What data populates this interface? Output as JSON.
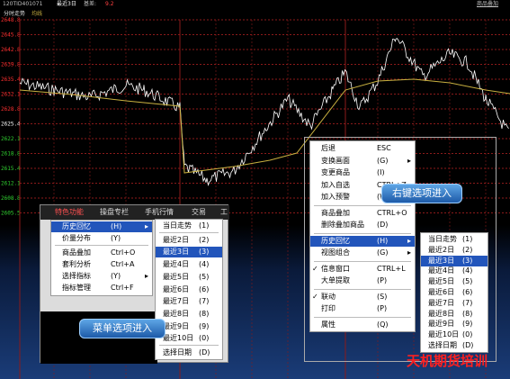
{
  "header": {
    "code": "120TID401071",
    "period_label": "最近3日",
    "base_label": "基差:",
    "base_value": "9.2",
    "overlay_label": "商品叠加"
  },
  "subheader": {
    "chart_title": "分时走势",
    "avg_label": "均线"
  },
  "yaxis": {
    "labels": [
      "2648.8",
      "2645.8",
      "2642.8",
      "2639.8",
      "2635.4",
      "2632.1",
      "2628.8",
      "2625.4",
      "2622.1",
      "2618.8",
      "2615.4",
      "2612.1",
      "2608.8",
      "2605.5"
    ]
  },
  "colors": {
    "price_line": "#ffffff",
    "avg_line": "#c8b040",
    "grid": "#8b1a1a",
    "highlight": "#2255bb",
    "accent": "#ff2020"
  },
  "left_window": {
    "tabs": [
      "特色功能",
      "操盘专栏",
      "手机行情",
      "交易",
      "工"
    ],
    "menu": [
      {
        "label": "历史回忆",
        "key": "(H)",
        "arrow": "▸",
        "highlighted": true
      },
      {
        "label": "价量分布",
        "key": "(Y)"
      },
      {
        "label": "商品叠加",
        "key": "Ctrl+O"
      },
      {
        "label": "套利分析",
        "key": "Ctrl+A"
      },
      {
        "label": "选择指标",
        "key": "(Y)",
        "arrow": "▸"
      },
      {
        "label": "指标管理",
        "key": "Ctrl+F"
      }
    ],
    "submenu": [
      {
        "label": "当日走势",
        "key": "(1)"
      },
      {
        "label": "最近2日",
        "key": "(2)"
      },
      {
        "label": "最近3日",
        "key": "(3)",
        "highlighted": true
      },
      {
        "label": "最近4日",
        "key": "(4)"
      },
      {
        "label": "最近5日",
        "key": "(5)"
      },
      {
        "label": "最近6日",
        "key": "(6)"
      },
      {
        "label": "最近7日",
        "key": "(7)"
      },
      {
        "label": "最近8日",
        "key": "(8)"
      },
      {
        "label": "最近9日",
        "key": "(9)"
      },
      {
        "label": "最近10日",
        "key": "(0)"
      },
      {
        "label": "选择日期",
        "key": "(D)"
      }
    ],
    "callout": "菜单选项进入"
  },
  "right_window": {
    "menu": [
      {
        "label": "后退",
        "key": "ESC"
      },
      {
        "label": "变换画面",
        "key": "(G)",
        "arrow": "▸"
      },
      {
        "label": "变更商品",
        "key": "(I)"
      },
      {
        "label": "加入自选",
        "key": "CTRL+Z",
        "arrow": "▸"
      },
      {
        "label": "加入预警",
        "key": "(W)"
      },
      {
        "label": "商品叠加",
        "key": "CTRL+O"
      },
      {
        "label": "删除叠加商品",
        "key": "(D)"
      },
      {
        "label": "历史回忆",
        "key": "(H)",
        "arrow": "▸",
        "highlighted": true
      },
      {
        "label": "视图组合",
        "key": "(G)",
        "arrow": "▸"
      },
      {
        "label": "信息窗口",
        "key": "CTRL+L",
        "check": "✓"
      },
      {
        "label": "大单提取",
        "key": "(P)"
      },
      {
        "label": "联动",
        "key": "(S)",
        "check": "✓"
      },
      {
        "label": "打印",
        "key": "(P)"
      },
      {
        "label": "属性",
        "key": "(Q)"
      }
    ],
    "submenu": [
      {
        "label": "当日走势",
        "key": "(1)"
      },
      {
        "label": "最近2日",
        "key": "(2)"
      },
      {
        "label": "最近3日",
        "key": "(3)",
        "highlighted": true
      },
      {
        "label": "最近4日",
        "key": "(4)"
      },
      {
        "label": "最近5日",
        "key": "(5)"
      },
      {
        "label": "最近6日",
        "key": "(6)"
      },
      {
        "label": "最近7日",
        "key": "(7)"
      },
      {
        "label": "最近8日",
        "key": "(8)"
      },
      {
        "label": "最近9日",
        "key": "(9)"
      },
      {
        "label": "最近10日",
        "key": "(0)"
      },
      {
        "label": "选择日期",
        "key": "(D)"
      }
    ],
    "callout": "右键选项进入"
  },
  "watermark": "天机期货培训"
}
